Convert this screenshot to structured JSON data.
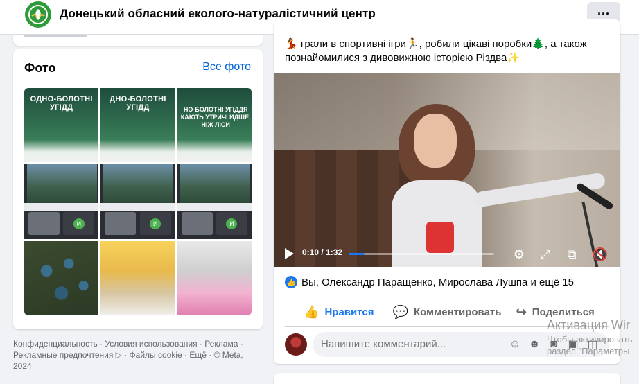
{
  "header": {
    "page_name": "Донецький обласний еколого-натуралістичний центр",
    "more_label": "···"
  },
  "photos": {
    "heading": "Фото",
    "all_link": "Все фото",
    "tiles": [
      {
        "kind": "wet",
        "caption": "ОДНО-БОЛОТНІ УГІДД",
        "caption2": ""
      },
      {
        "kind": "wet",
        "caption": "ДНО-БОЛОТНІ УГІДД",
        "caption2": ""
      },
      {
        "kind": "wet",
        "caption": "",
        "caption2": "НО-БОЛОТНІ УГІДДЯ КАЮТЬ УТРИЧІ ИДШЕ, НІЖ ЛІСИ"
      },
      {
        "kind": "screen",
        "caption": "",
        "caption2": ""
      },
      {
        "kind": "screen",
        "caption": "",
        "caption2": ""
      },
      {
        "kind": "screen",
        "caption": "",
        "caption2": ""
      },
      {
        "kind": "marsh",
        "caption": "",
        "caption2": ""
      },
      {
        "kind": "kids1",
        "caption": "",
        "caption2": ""
      },
      {
        "kind": "kids2",
        "caption": "",
        "caption2": ""
      }
    ]
  },
  "footer": {
    "text": "Конфиденциальность · Условия использования · Реклама · Рекламные предпочтения ▷ · Файлы cookie · Ещё · © Meta, 2024"
  },
  "post": {
    "text": "💃 грали в спортивні ігри🏃, робили цікаві поробки🌲, а також познайомилися з дивовижною історією Різдва✨",
    "video": {
      "time": "0:10 / 1:32",
      "progress": 0.11
    },
    "reactions": "Вы, Олександр Паращенко, Мирослава Лушпа и ещё 15",
    "actions": {
      "like": "Нравится",
      "comment": "Комментировать",
      "share": "Поделиться"
    },
    "comment_placeholder": "Напишите комментарий..."
  },
  "watermark": {
    "line1": "Активация Wir",
    "line2": "Чтобы активировать",
    "line3": "раздел \"Параметры"
  },
  "colors": {
    "accent": "#1877f2",
    "link": "#0064d1",
    "brand_green": "#2e9b3a"
  }
}
